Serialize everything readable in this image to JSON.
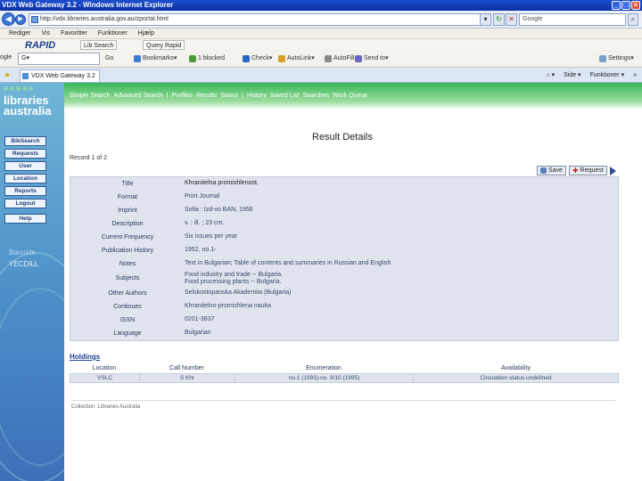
{
  "window": {
    "title": "VDX Web Gateway 3.2 - Windows Internet Explorer",
    "buttons": [
      "_",
      "□",
      "×"
    ]
  },
  "address": {
    "url": "http://vdx.libraries.australia.gov.au/zportal.html",
    "go_label": "▾",
    "refresh_label": "↻",
    "stop_label": "✕",
    "search_value": "Google"
  },
  "menu": {
    "items": [
      "Rediger",
      "Vis",
      "Favoritter",
      "Funktioner",
      "Hjælp"
    ]
  },
  "toolbar1": {
    "logo": "RAPID",
    "items": [
      "Lib Search",
      "Query Rapid"
    ]
  },
  "toolbar2": {
    "google_label": "ogle",
    "google_value": "G▾",
    "items": [
      "Go",
      "Bookmarks▾",
      "1 blocked",
      "Check▾",
      "AutoLink▾",
      "AutoFill",
      "Send to▾"
    ],
    "right_items": [
      "Settings▾"
    ]
  },
  "tabbar": {
    "tab_label": "VDX Web Gateway 3.2",
    "right_items": [
      "⌂ ▾",
      "Side ▾",
      "Funktioner ▾",
      "»"
    ]
  },
  "sidebar": {
    "logo_line1": "libraries",
    "logo_line2": "australia",
    "buttons": [
      "BibSearch",
      "Requests",
      "User",
      "Location",
      "Reports",
      "Logout",
      "Help"
    ],
    "barcode_label": "Barcode",
    "barcode_value": "YECDILL"
  },
  "topnav": {
    "items": [
      "Simple Search",
      "Advanced Search",
      "Profiles",
      "Results",
      "Status",
      "History",
      "Saved List",
      "Searches",
      "Work Queue"
    ]
  },
  "page": {
    "title": "Result Details",
    "record_line": "Record 1 of 2",
    "save_label": "Save",
    "request_label": "Request"
  },
  "details": [
    {
      "label": "Title",
      "value": "Khranitelna promishlenost."
    },
    {
      "label": "Format",
      "value": "Print Journal"
    },
    {
      "label": "Imprint",
      "value": "Sofia : Izd-vo BAN, 1956"
    },
    {
      "label": "Description",
      "value": "v. : ill. ; 23 cm."
    },
    {
      "label": "Current Frequency",
      "value": "Six issues per year"
    },
    {
      "label": "Publication History",
      "value": "1952, no.1-"
    },
    {
      "label": "Notes",
      "value": "Text in Bulgarian; Table of contents and summaries in Russian and English"
    },
    {
      "label": "Subjects",
      "value": "Food industry and trade -- Bulgaria.",
      "value2": "Food processing plants -- Bulgaria."
    },
    {
      "label": "Other Authors",
      "value": "Selskostopanska Akademiia (Bulgaria)"
    },
    {
      "label": "Continues",
      "value": "Khranitelno-promishlena nauka"
    },
    {
      "label": "ISSN",
      "value": "0201-3837"
    },
    {
      "label": "Language",
      "value": "Bulgarian"
    }
  ],
  "holdings": {
    "title": "Holdings",
    "headers": [
      "Location",
      "Call Number",
      "Enumeration",
      "Availability"
    ],
    "rows": [
      [
        "VSLC",
        "S Khr",
        "no.1 (1993)-no. 9/10 (1995)",
        "Circulation status undefined"
      ]
    ]
  },
  "footer": {
    "text": "Collection: Libraries Australia"
  }
}
